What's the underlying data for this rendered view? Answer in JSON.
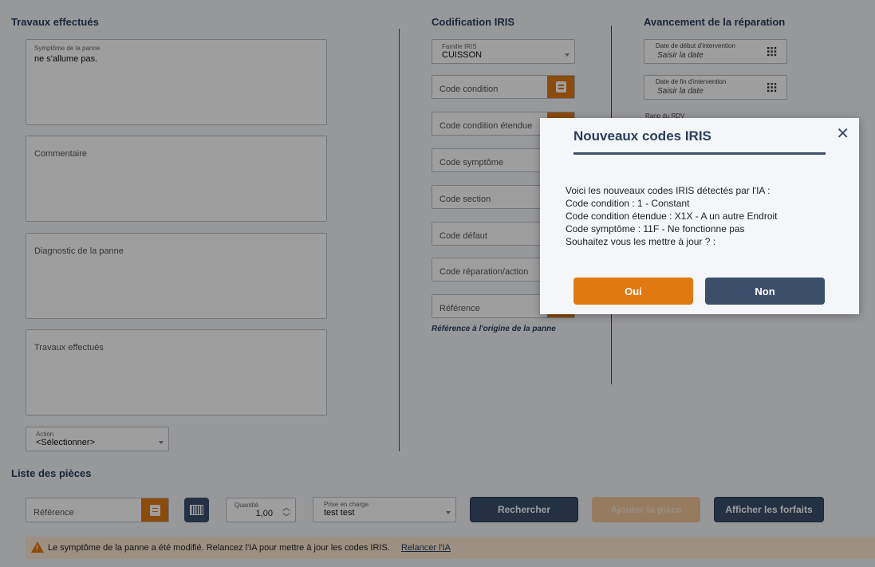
{
  "travaux": {
    "title": "Travaux effectués",
    "symptome_label": "Symptôme de la panne",
    "symptome_value": "ne s'allume pas.",
    "commentaire_label": "Commentaire",
    "diagnostic_label": "Diagnostic de la panne",
    "travaux_label": "Travaux effectués",
    "action_label": "Action",
    "action_value": "<Sélectionner>"
  },
  "iris": {
    "title": "Codification IRIS",
    "famille_label": "Famille IRIS",
    "famille_value": "CUISSON",
    "fields": [
      {
        "label": "Code condition"
      },
      {
        "label": "Code condition étendue"
      },
      {
        "label": "Code symptôme"
      },
      {
        "label": "Code section"
      },
      {
        "label": "Code défaut"
      },
      {
        "label": "Code réparation/action"
      },
      {
        "label": "Référence"
      }
    ],
    "reference_note": "Référence à l'origine de la panne"
  },
  "avancement": {
    "title": "Avancement de la réparation",
    "debut_label": "Date de début d'intervention",
    "fin_label": "Date de fin d'intervention",
    "date_placeholder": "Saisir la date",
    "rang_label": "Rang du RDV"
  },
  "pieces": {
    "title": "Liste des pièces",
    "reference_placeholder": "Référence",
    "quantite_label": "Quantité",
    "quantite_value": "1,00",
    "prise_label": "Prise en charge",
    "prise_value": "test test",
    "rechercher": "Rechercher",
    "ajouter": "Ajouter la pièce",
    "forfaits": "Afficher les forfaits"
  },
  "warning": {
    "text": "Le symptôme de la panne a été modifié. Relancez l'IA pour mettre à jour les codes IRIS.",
    "link": "Relancer l'IA"
  },
  "modal": {
    "title": "Nouveaux codes IRIS",
    "line1": "Voici les nouveaux codes IRIS détectés par l'IA :",
    "line2": "Code condition : 1 - Constant",
    "line3": "Code condition étendue : X1X - A un autre Endroit",
    "line4": "Code symptôme : 11F - Ne fonctionne pas",
    "line5": "Souhaitez vous les mettre à jour ? :",
    "oui": "Oui",
    "non": "Non"
  },
  "colors": {
    "accent": "#e07a10",
    "navy": "#3b4f6b",
    "title": "#2b3e5c"
  }
}
